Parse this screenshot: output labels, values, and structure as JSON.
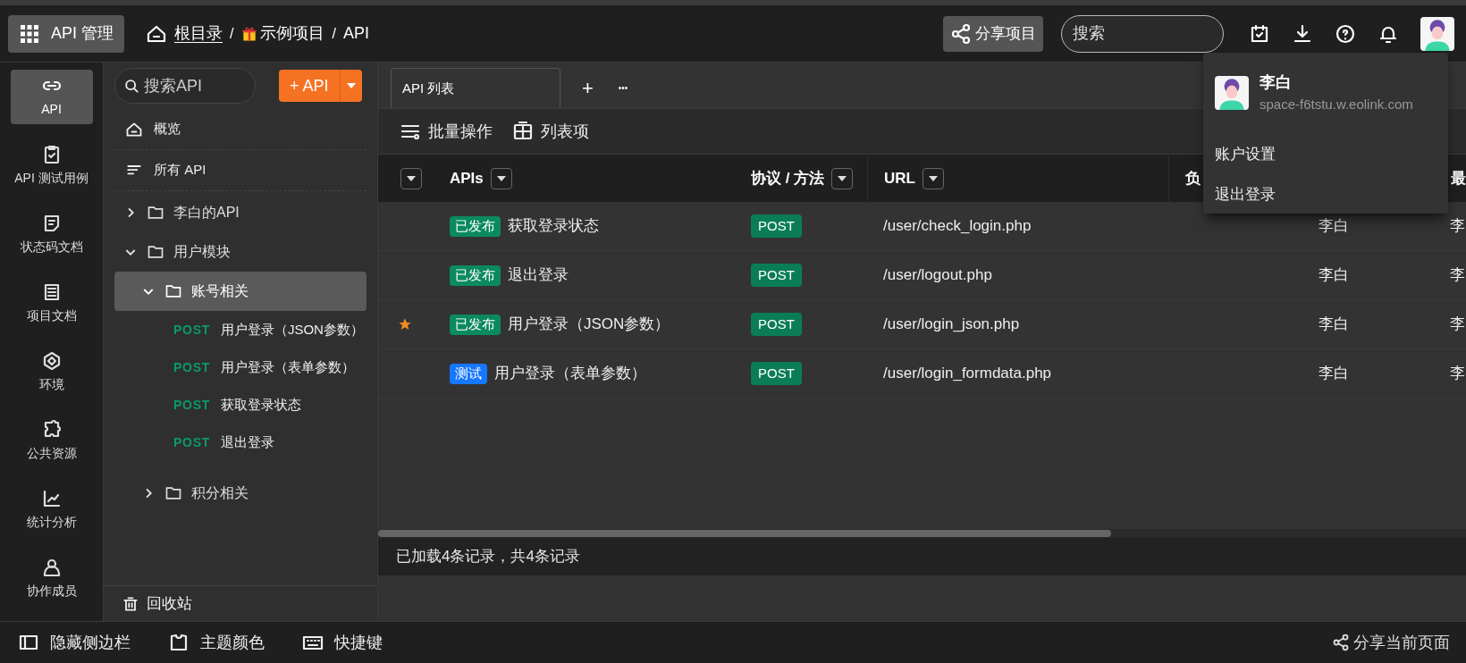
{
  "header": {
    "app_button": "API 管理",
    "breadcrumb": [
      {
        "label": "根目录",
        "kind": "home"
      },
      {
        "separator": "/",
        "label": "示例项目",
        "kind": "project"
      },
      {
        "separator": "/",
        "label": "API",
        "kind": "plain"
      }
    ],
    "share_button": "分享项目",
    "search": {
      "placeholder": "搜索"
    }
  },
  "rail": [
    {
      "label": "API",
      "selected": true
    },
    {
      "label": "API 测试用例",
      "selected": false
    },
    {
      "label": "状态码文档",
      "selected": false
    },
    {
      "label": "项目文档",
      "selected": false
    },
    {
      "label": "环境",
      "selected": false
    },
    {
      "label": "公共资源",
      "selected": false
    },
    {
      "label": "统计分析",
      "selected": false
    },
    {
      "label": "协作成员",
      "selected": false
    }
  ],
  "tree": {
    "search": {
      "placeholder": "搜索API"
    },
    "add_button": "+ API",
    "links": [
      "概览",
      "所有 API"
    ],
    "items": [
      {
        "label": "李白的API",
        "kind": "folder",
        "expanded": false,
        "selected": false
      },
      {
        "label": "用户模块",
        "kind": "folder",
        "expanded": true,
        "selected": false,
        "children": [
          {
            "label": "账号相关",
            "kind": "folder",
            "expanded": true,
            "selected": true,
            "children": [
              {
                "label": "用户登录（JSON参数）",
                "kind": "api",
                "method": "POST",
                "selected": false
              },
              {
                "label": "用户登录（表单参数）",
                "kind": "api",
                "method": "POST",
                "selected": false
              },
              {
                "label": "获取登录状态",
                "kind": "api",
                "method": "POST",
                "selected": false
              },
              {
                "label": "退出登录",
                "kind": "api",
                "method": "POST",
                "selected": false
              }
            ]
          },
          {
            "label": "积分相关",
            "kind": "folder",
            "expanded": false,
            "selected": false
          }
        ]
      }
    ],
    "recycle": "回收站"
  },
  "tabs": [
    {
      "label": "API 列表",
      "selected": true
    }
  ],
  "tab_add": "+",
  "tab_more": "•••",
  "toolbar": [
    "批量操作",
    "列表项"
  ],
  "table": {
    "columns": [
      "APIs",
      "协议 / 方法",
      "URL",
      "负",
      "最"
    ],
    "rows": [
      {
        "starred": false,
        "status": "已发布",
        "color": "#0b8a5e",
        "name": "获取登录状态",
        "method": "POST",
        "url": "/user/check_login.php",
        "column_4": "李白",
        "column_5": "李"
      },
      {
        "starred": false,
        "status": "已发布",
        "color": "#0b8a5e",
        "name": "退出登录",
        "method": "POST",
        "url": "/user/logout.php",
        "column_4": "李白",
        "column_5": "李"
      },
      {
        "starred": true,
        "status": "已发布",
        "color": "#0b8a5e",
        "name": "用户登录（JSON参数）",
        "method": "POST",
        "url": "/user/login_json.php",
        "column_4": "李白",
        "column_5": "李"
      },
      {
        "starred": false,
        "status": "测试",
        "color": "#1677ff",
        "name": "用户登录（表单参数）",
        "method": "POST",
        "url": "/user/login_formdata.php",
        "column_4": "李白",
        "column_5": "李"
      }
    ]
  },
  "status_bar": "已加载4条记录，共4条记录",
  "user_menu": {
    "name": "李白",
    "domain": "space-f6tstu.w.eolink.com",
    "items": [
      "账户设置",
      "退出登录"
    ]
  },
  "footer": [
    "隐藏侧边栏",
    "主题颜色",
    "快捷键"
  ],
  "footer_right": "分享当前页面"
}
